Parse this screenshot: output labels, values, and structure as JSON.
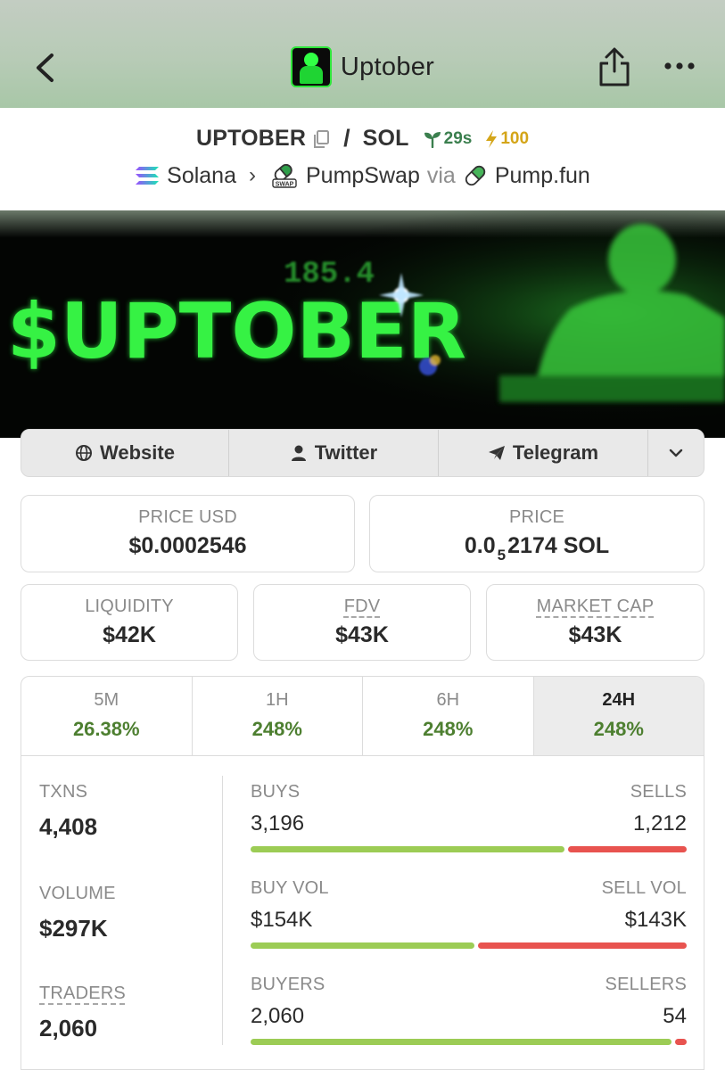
{
  "nav": {
    "title": "Uptober",
    "back_icon": "chevron-left-icon",
    "share_icon": "share-icon",
    "more_icon": "more-horizontal-icon"
  },
  "pair": {
    "base": "UPTOBER",
    "separator": "/",
    "quote": "SOL",
    "age": "29s",
    "boost": "100",
    "chain": "Solana",
    "dex": "PumpSwap",
    "via": "via",
    "launchpad": "Pump.fun"
  },
  "banner": {
    "text": "$UPTOBER",
    "overlay_number": "185.4"
  },
  "links": {
    "website": "Website",
    "twitter": "Twitter",
    "telegram": "Telegram"
  },
  "stats": {
    "price_usd_label": "PRICE USD",
    "price_usd": "$0.0002546",
    "price_label": "PRICE",
    "price_prefix": "0.0",
    "price_zeros": "5",
    "price_suffix": "2174 SOL",
    "liquidity_label": "LIQUIDITY",
    "liquidity": "$42K",
    "fdv_label": "FDV",
    "fdv": "$43K",
    "mcap_label": "MARKET CAP",
    "mcap": "$43K"
  },
  "timeframes": [
    {
      "label": "5M",
      "change": "26.38%"
    },
    {
      "label": "1H",
      "change": "248%"
    },
    {
      "label": "6H",
      "change": "248%"
    },
    {
      "label": "24H",
      "change": "248%",
      "active": true
    }
  ],
  "txns": {
    "txns_label": "TXNS",
    "txns": "4,408",
    "volume_label": "VOLUME",
    "volume": "$297K",
    "traders_label": "TRADERS",
    "traders": "2,060",
    "buys_label": "BUYS",
    "buys": "3,196",
    "sells_label": "SELLS",
    "sells": "1,212",
    "buy_share": 0.725,
    "buy_vol_label": "BUY VOL",
    "buy_vol": "$154K",
    "sell_vol_label": "SELL VOL",
    "sell_vol": "$143K",
    "buy_vol_share": 0.518,
    "buyers_label": "BUYERS",
    "buyers": "2,060",
    "sellers_label": "SELLERS",
    "sellers": "54",
    "buyer_share": 0.974
  },
  "colors": {
    "positive": "#4d7f30",
    "buy_bar": "#9ccc55",
    "sell_bar": "#e8534f",
    "age_green": "#3b7f4e",
    "boost_gold": "#d4a518",
    "banner_green": "#2ee53a"
  }
}
